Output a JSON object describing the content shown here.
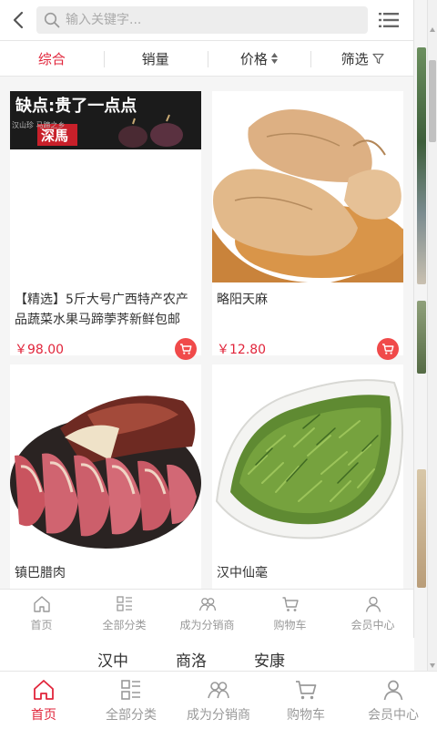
{
  "search": {
    "placeholder": "输入关键字..."
  },
  "sort_tabs": [
    {
      "label": "综合",
      "active": true
    },
    {
      "label": "销量"
    },
    {
      "label": "价格"
    },
    {
      "label": "筛选"
    }
  ],
  "products": [
    {
      "title": "【精选】5斤大号广西特产农产品蔬菜水果马蹄荸荠新鲜包邮",
      "price": "￥98.00",
      "banner_text": "缺点:贵了一点点",
      "banner_sub": "深馬",
      "banner_small": "汉山珍 马蹄之乡"
    },
    {
      "title": "略阳天麻",
      "price": "￥12.80"
    },
    {
      "title": "镇巴腊肉",
      "price": ""
    },
    {
      "title": "汉中仙毫",
      "price": ""
    }
  ],
  "inner_tabbar": [
    {
      "label": "首页",
      "icon": "home-icon"
    },
    {
      "label": "全部分类",
      "icon": "category-icon"
    },
    {
      "label": "成为分销商",
      "icon": "distributor-icon"
    },
    {
      "label": "购物车",
      "icon": "cart-icon"
    },
    {
      "label": "会员中心",
      "icon": "user-icon"
    }
  ],
  "cities": [
    "汉中",
    "商洛",
    "安康"
  ],
  "main_tabbar": [
    {
      "label": "首页",
      "icon": "home-icon",
      "active": true
    },
    {
      "label": "全部分类",
      "icon": "category-icon"
    },
    {
      "label": "成为分销商",
      "icon": "distributor-icon"
    },
    {
      "label": "购物车",
      "icon": "cart-icon"
    },
    {
      "label": "会员中心",
      "icon": "user-icon"
    }
  ],
  "colors": {
    "accent": "#e1253b",
    "cart": "#f04a4a",
    "muted": "#999999"
  }
}
